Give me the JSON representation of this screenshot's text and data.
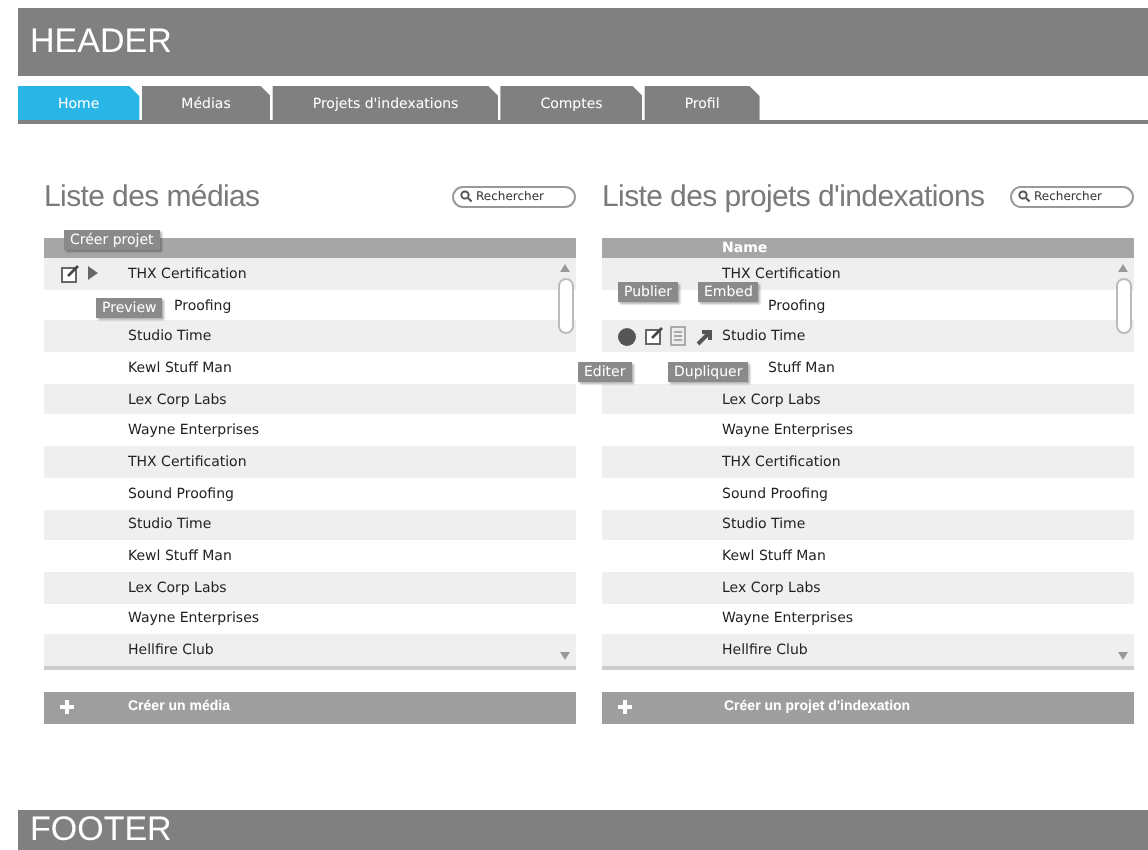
{
  "header": {
    "title": "HEADER"
  },
  "tabs": [
    {
      "label": "Home",
      "selected": true
    },
    {
      "label": "Médias",
      "selected": false
    },
    {
      "label": "Projets d'indexations",
      "selected": false
    },
    {
      "label": "Comptes",
      "selected": false
    },
    {
      "label": "Profil",
      "selected": false
    }
  ],
  "panels": [
    {
      "title": "Liste des médias",
      "search": {
        "placeholder": "Rechercher"
      },
      "header_tooltips": [
        {
          "kind": "create",
          "text": "Créer projet"
        }
      ],
      "rows": [
        {
          "name": "THX Certification",
          "actions": [
            {
              "kind": "edit"
            },
            {
              "kind": "play"
            }
          ]
        },
        {
          "name": "Proofing",
          "tooltips": [
            {
              "kind": "preview",
              "text": "Preview"
            }
          ]
        },
        {
          "name": "Studio Time"
        },
        {
          "name": "Kewl Stuff Man"
        },
        {
          "name": "Lex Corp Labs"
        },
        {
          "name": "Wayne Enterprises"
        },
        {
          "name": "THX Certification"
        },
        {
          "name": "Sound Proofing"
        },
        {
          "name": "Studio Time"
        },
        {
          "name": "Kewl Stuff Man"
        },
        {
          "name": "Lex Corp Labs"
        },
        {
          "name": "Wayne Enterprises"
        },
        {
          "name": "Hellfire Club"
        }
      ],
      "create_button": "Créer un média"
    },
    {
      "title": "Liste des projets d'indexations",
      "search": {
        "placeholder": "Rechercher"
      },
      "column": "Name",
      "rows": [
        {
          "name": "THX Certification"
        },
        {
          "name": "Proofing",
          "tooltips": [
            {
              "kind": "publish",
              "text": "Publier"
            },
            {
              "kind": "embed",
              "text": "Embed"
            }
          ]
        },
        {
          "name": "Studio Time",
          "actions": [
            {
              "kind": "publish"
            },
            {
              "kind": "edit"
            },
            {
              "kind": "duplicate"
            },
            {
              "kind": "embed"
            }
          ]
        },
        {
          "name": "Stuff Man",
          "tooltips": [
            {
              "kind": "edit",
              "text": "Editer"
            },
            {
              "kind": "duplicate",
              "text": "Dupliquer"
            }
          ]
        },
        {
          "name": "Lex Corp Labs"
        },
        {
          "name": "Wayne Enterprises"
        },
        {
          "name": "THX Certification"
        },
        {
          "name": "Sound Proofing"
        },
        {
          "name": "Studio Time"
        },
        {
          "name": "Kewl Stuff Man"
        },
        {
          "name": "Lex Corp Labs"
        },
        {
          "name": "Wayne Enterprises"
        },
        {
          "name": "Hellfire Club"
        }
      ],
      "create_button": "Créer un projet d'indexation"
    }
  ],
  "footer": {
    "title": "FOOTER"
  }
}
